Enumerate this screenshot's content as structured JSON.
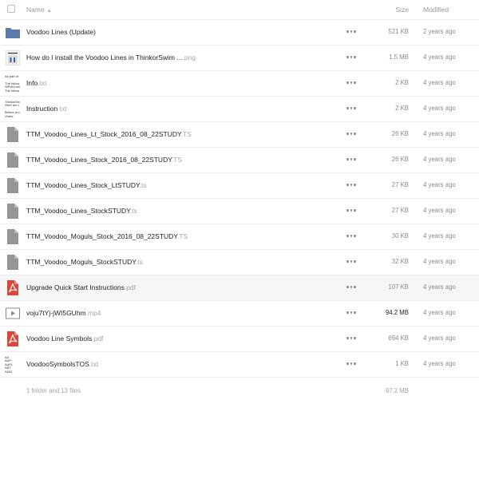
{
  "header": {
    "name": "Name",
    "sort_indicator": "▲",
    "size": "Size",
    "modified": "Modified"
  },
  "files": [
    {
      "icon": "folder-icon",
      "base": "Voodoo Lines (Update)",
      "ext": "",
      "size": "521 KB",
      "modified": "2 years ago"
    },
    {
      "icon": "image-thumbnail-icon",
      "base": "How do I install the Voodoo Lines in ThinkorSwim ...",
      "ext": ".png",
      "size": "1.5 MB",
      "modified": "4 years ago"
    },
    {
      "icon": "text-thumbnail-icon",
      "base": "Info",
      "ext": ".txt",
      "size": "2 KB",
      "modified": "4 years ago"
    },
    {
      "icon": "text-thumbnail-icon",
      "base": "Instruction",
      "ext": ".txt",
      "size": "2 KB",
      "modified": "4 years ago"
    },
    {
      "icon": "file-icon",
      "base": "TTM_Voodoo_Lines_Lt_Stock_2016_08_22STUDY",
      "ext": ".TS",
      "size": "26 KB",
      "modified": "4 years ago"
    },
    {
      "icon": "file-icon",
      "base": "TTM_Voodoo_Lines_Stock_2016_08_22STUDY",
      "ext": ".TS",
      "size": "26 KB",
      "modified": "4 years ago"
    },
    {
      "icon": "file-icon",
      "base": "TTM_Voodoo_Lines_Stock_LtSTUDY",
      "ext": ".ts",
      "size": "27 KB",
      "modified": "4 years ago"
    },
    {
      "icon": "file-icon",
      "base": "TTM_Voodoo_Lines_StockSTUDY",
      "ext": ".ts",
      "size": "27 KB",
      "modified": "4 years ago"
    },
    {
      "icon": "file-icon",
      "base": "TTM_Voodoo_Moguls_Stock_2016_08_22STUDY",
      "ext": ".TS",
      "size": "30 KB",
      "modified": "4 years ago"
    },
    {
      "icon": "file-icon",
      "base": "TTM_Voodoo_Moguls_StockSTUDY",
      "ext": ".ts",
      "size": "32 KB",
      "modified": "4 years ago"
    },
    {
      "icon": "pdf-icon",
      "base": "Upgrade Quick Start Instructions",
      "ext": ".pdf",
      "size": "107 KB",
      "modified": "4 years ago"
    },
    {
      "icon": "video-icon",
      "base": "voju7tYj-jWI5GUhm",
      "ext": ".mp4",
      "size": "94.2 MB",
      "modified": "4 years ago"
    },
    {
      "icon": "pdf-icon",
      "base": "Voodoo Line Symbols",
      "ext": ".pdf",
      "size": "694 KB",
      "modified": "4 years ago"
    },
    {
      "icon": "text-thumbnail-icon",
      "base": "VoodooSymbolsTOS",
      "ext": ".txt",
      "size": "1 KB",
      "modified": "4 years ago"
    }
  ],
  "thumbnails": {
    "info": [
      "As part of",
      "",
      "The follow",
      "WPW:Insti",
      "The follow"
    ],
    "instruction": [
      "ThinkorSw",
      "Here are t",
      "",
      "Before pro",
      "Video:"
    ],
    "symbols": [
      "AA",
      "AAP",
      "AAPL",
      "ABT",
      "ADM"
    ]
  },
  "footer": {
    "summary": "1 folder and 13 files",
    "total_size": "97.2 MB"
  },
  "colors": {
    "folder": "#5a7aab",
    "file": "#959595",
    "pdf": "#d9483b",
    "video": "#8a8a8a"
  }
}
